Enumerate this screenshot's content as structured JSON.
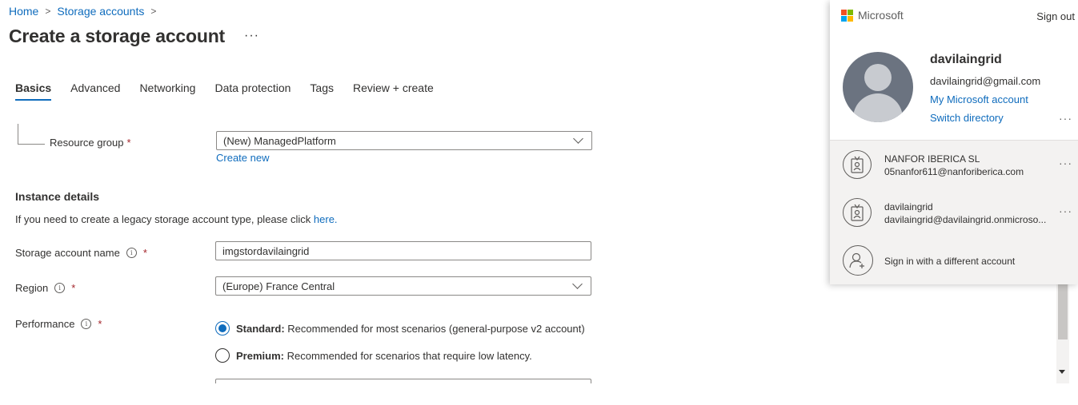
{
  "breadcrumb": {
    "home": "Home",
    "storage_accounts": "Storage accounts",
    "sep": ">"
  },
  "page": {
    "title": "Create a storage account",
    "more": "···"
  },
  "tabs": [
    {
      "label": "Basics",
      "active": true
    },
    {
      "label": "Advanced"
    },
    {
      "label": "Networking"
    },
    {
      "label": "Data protection"
    },
    {
      "label": "Tags"
    },
    {
      "label": "Review + create"
    }
  ],
  "form": {
    "resource_group": {
      "label": "Resource group",
      "required": "*",
      "value": "(New) ManagedPlatform",
      "create_new": "Create new"
    },
    "instance_details": {
      "title": "Instance details",
      "legacy_text": "If you need to create a legacy storage account type, please click",
      "legacy_link": "here."
    },
    "storage_account_name": {
      "label": "Storage account name",
      "required": "*",
      "value": "imgstordavilaingrid"
    },
    "region": {
      "label": "Region",
      "required": "*",
      "value": "(Europe) France Central"
    },
    "performance": {
      "label": "Performance",
      "required": "*",
      "options": [
        {
          "title": "Standard:",
          "desc": "Recommended for most scenarios (general-purpose v2 account)",
          "selected": true
        },
        {
          "title": "Premium:",
          "desc": "Recommended for scenarios that require low latency.",
          "selected": false
        }
      ]
    }
  },
  "account_panel": {
    "brand": "Microsoft",
    "sign_out": "Sign out",
    "user_name": "davilaingrid",
    "user_email": "davilaingrid@gmail.com",
    "my_account": "My Microsoft account",
    "switch_directory": "Switch directory",
    "more": "···",
    "accounts": [
      {
        "name": "NANFOR IBERICA SL",
        "email": "05nanfor611@nanforiberica.com"
      },
      {
        "name": "davilaingrid",
        "email": "davilaingrid@davilaingrid.onmicroso..."
      }
    ],
    "different_account": "Sign in with a different account"
  },
  "colors": {
    "accent": "#0f6cbd",
    "required": "#a4262c",
    "ms_red": "#f25022",
    "ms_green": "#7fba00",
    "ms_blue": "#00a4ef",
    "ms_yellow": "#ffb900"
  }
}
